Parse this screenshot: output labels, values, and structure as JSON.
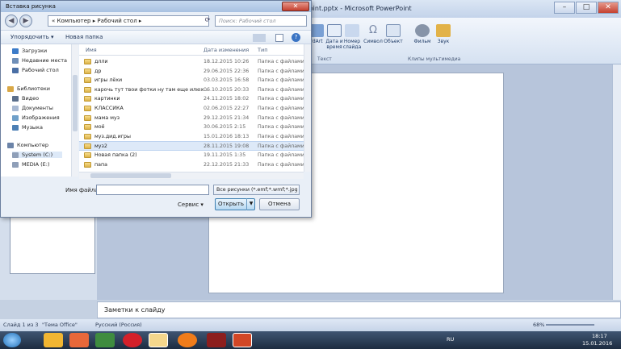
{
  "ppt": {
    "title": "erPoint.pptx - Microsoft PowerPoint",
    "ribbon_buttons": [
      {
        "label": "rdArt"
      },
      {
        "label": "Дата и время"
      },
      {
        "label": "Номер слайда"
      },
      {
        "label": "Символ"
      },
      {
        "label": "Объект"
      },
      {
        "label": "Фильм"
      },
      {
        "label": "Звук"
      }
    ],
    "group_text": "Текст",
    "group_media": "Клипы мультимедиа",
    "notes_placeholder": "Заметки к слайду",
    "status": {
      "slide": "Слайд 1 из 3",
      "theme": "\"Тема Office\"",
      "language": "Русский (Россия)",
      "zoom": "68%"
    }
  },
  "taskbar": {
    "lang": "RU",
    "time": "18:17",
    "date": "15.01.2016"
  },
  "dialog": {
    "title": "Вставка рисунка",
    "address": "« Компьютер ▸ Рабочий стол ▸",
    "search_placeholder": "Поиск: Рабочий стол",
    "organize": "Упорядочить ▾",
    "new_folder": "Новая папка",
    "nav_items": [
      {
        "label": "Загрузки",
        "color": "#3d7cc9"
      },
      {
        "label": "Недавние места",
        "color": "#6f8fb8"
      },
      {
        "label": "Рабочий стол",
        "color": "#4a6fa5"
      },
      {
        "label": "Библиотеки",
        "color": "#d9a847"
      },
      {
        "label": "Видео",
        "color": "#5b6f8c"
      },
      {
        "label": "Документы",
        "color": "#a9bad3"
      },
      {
        "label": "Изображения",
        "color": "#6fa0c9"
      },
      {
        "label": "Музыка",
        "color": "#4c7fb4"
      },
      {
        "label": "Компьютер",
        "color": "#6c84a8"
      },
      {
        "label": "System (C:)",
        "color": "#8f9fb8"
      },
      {
        "label": "MEDIA (E:)",
        "color": "#8f9fb8"
      }
    ],
    "columns": {
      "name": "Имя",
      "date": "Дата изменения",
      "type": "Тип"
    },
    "files": [
      {
        "name": "длли",
        "date": "18.12.2015 10:26",
        "type": "Папка с файлами"
      },
      {
        "name": "др",
        "date": "29.06.2015 22:36",
        "type": "Папка с файлами"
      },
      {
        "name": "игры лёхи",
        "date": "03.03.2015 16:58",
        "type": "Папка с файлами"
      },
      {
        "name": "карочь тут твои фотки ну там еще илюх...",
        "date": "06.10.2015 20:33",
        "type": "Папка с файлами"
      },
      {
        "name": "картинки",
        "date": "24.11.2015 18:02",
        "type": "Папка с файлами"
      },
      {
        "name": "КЛАССИКА",
        "date": "02.06.2015 22:27",
        "type": "Папка с файлами"
      },
      {
        "name": "мама муз",
        "date": "29.12.2015 21:34",
        "type": "Папка с файлами"
      },
      {
        "name": "моё",
        "date": "30.06.2015 2:15",
        "type": "Папка с файлами"
      },
      {
        "name": "муз.дид.игры",
        "date": "15.01.2016 18:13",
        "type": "Папка с файлами"
      },
      {
        "name": "муз2",
        "date": "28.11.2015 19:08",
        "type": "Папка с файлами"
      },
      {
        "name": "Новая папка (2)",
        "date": "19.11.2015 1:35",
        "type": "Папка с файлами"
      },
      {
        "name": "папа",
        "date": "22.12.2015 21:33",
        "type": "Папка с файлами"
      }
    ],
    "filename_label": "Имя файла:",
    "filename_value": "",
    "filetype": "Все рисунки (*.emf;*.wmf;*.jpg",
    "service": "Сервис ▾",
    "open": "Открыть",
    "cancel": "Отмена"
  }
}
